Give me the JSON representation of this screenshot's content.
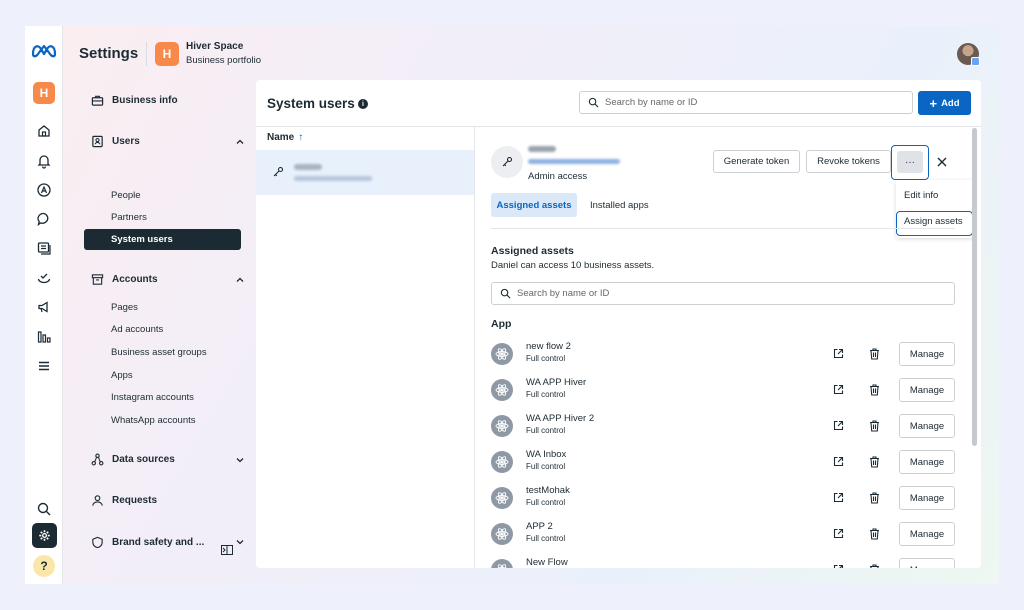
{
  "header": {
    "title": "Settings",
    "business_initial": "H",
    "business_name": "Hiver Space",
    "business_type": "Business portfolio"
  },
  "rail": {
    "business_initial": "H",
    "help_label": "?",
    "icons": [
      "meta-logo",
      "home-icon",
      "notifications-icon",
      "ads-manager-icon",
      "messages-icon",
      "content-icon",
      "monetization-icon",
      "campaigns-icon",
      "insights-icon",
      "menu-icon",
      "search-icon",
      "settings-icon",
      "help-icon"
    ]
  },
  "nav": {
    "business_info": "Business info",
    "users": {
      "label": "Users",
      "items": [
        "People",
        "Partners",
        "System users"
      ]
    },
    "accounts": {
      "label": "Accounts",
      "items": [
        "Pages",
        "Ad accounts",
        "Business asset groups",
        "Apps",
        "Instagram accounts",
        "WhatsApp accounts"
      ]
    },
    "data_sources": "Data sources",
    "requests": "Requests",
    "brand_safety": "Brand safety and ..."
  },
  "main": {
    "title": "System users",
    "search_placeholder": "Search by name or ID",
    "add_label": "Add",
    "column_name": "Name",
    "sort_arrow": "↑"
  },
  "detail": {
    "role": "Admin access",
    "generate_tokens": "Generate token",
    "revoke_tokens": "Revoke tokens",
    "more_label": "···",
    "menu": [
      "Edit info",
      "Assign assets"
    ],
    "tabs": [
      "Assigned assets",
      "Installed apps"
    ],
    "assets_title": "Assigned assets",
    "assets_subtitle": "Daniel can access 10 business assets.",
    "assets_search_placeholder": "Search by name or ID",
    "section_label": "App",
    "manage_label": "Manage",
    "assets": [
      {
        "name": "new flow 2",
        "permission": "Full control"
      },
      {
        "name": "WA APP Hiver",
        "permission": "Full control"
      },
      {
        "name": "WA APP Hiver 2",
        "permission": "Full control"
      },
      {
        "name": "WA Inbox",
        "permission": "Full control"
      },
      {
        "name": "testMohak",
        "permission": "Full control"
      },
      {
        "name": "APP 2",
        "permission": "Full control"
      },
      {
        "name": "New Flow",
        "permission": ""
      }
    ]
  },
  "colors": {
    "accent": "#0a66c2",
    "brand_orange": "#f7894a",
    "dark": "#1c2b33"
  }
}
